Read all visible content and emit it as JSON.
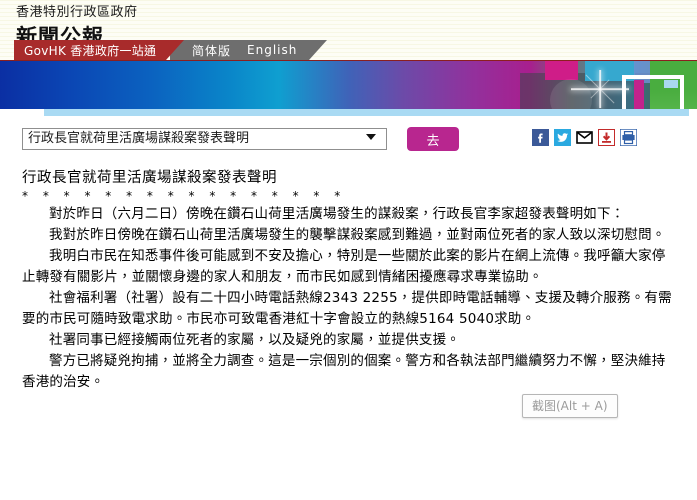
{
  "header": {
    "gov_name": "香港特別行政區政府",
    "press_title": "新聞公報",
    "tabs": {
      "govhk": "GovHK 香港政府一站通",
      "simplified": "简体版",
      "english": "English"
    }
  },
  "controls": {
    "selected_story": "行政長官就荷里活廣場謀殺案發表聲明",
    "go_label": "去",
    "share": [
      {
        "name": "facebook-share-icon",
        "color": "#3b5998"
      },
      {
        "name": "twitter-share-icon",
        "color": "#2aa9e0"
      },
      {
        "name": "email-share-icon",
        "color": "#000000"
      },
      {
        "name": "download-icon",
        "color": "#c32b2b"
      },
      {
        "name": "print-icon",
        "color": "#2f5fa8"
      }
    ]
  },
  "article": {
    "title": "行政長官就荷里活廣場謀殺案發表聲明",
    "divider": "* * * * * * * * * * * * * * * *",
    "paragraphs": [
      "對於昨日（六月二日）傍晚在鑽石山荷里活廣場發生的謀殺案，行政長官李家超發表聲明如下：",
      "我對於昨日傍晚在鑽石山荷里活廣場發生的襲擊謀殺案感到難過，並對兩位死者的家人致以深切慰問。",
      "我明白市民在知悉事件後可能感到不安及擔心，特別是一些關於此案的影片在網上流傳。我呼籲大家停止轉發有關影片，並關懷身邊的家人和朋友，而市民如感到情緒困擾應尋求專業協助。",
      "社會福利署（社署）設有二十四小時電話熱線2343 2255，提供即時電話輔導、支援及轉介服務。有需要的市民可隨時致電求助。市民亦可致電香港紅十字會設立的熱線5164 5040求助。",
      "社署同事已經接觸兩位死者的家屬，以及疑兇的家屬，並提供支援。",
      "警方已將疑兇拘捕，並將全力調查。這是一宗個別的個案。警方和各執法部門繼續努力不懈，堅決維持香港的治安。"
    ]
  },
  "overlay": {
    "screenshot_tooltip": "截图(Alt + A)"
  },
  "colors": {
    "govhk_tab": "#a82b2b",
    "lang_tab": "#6e6e6e",
    "go_button": "#b8268f",
    "header_bg": "#fbfbee",
    "blue_strip": "#a9daf3"
  }
}
